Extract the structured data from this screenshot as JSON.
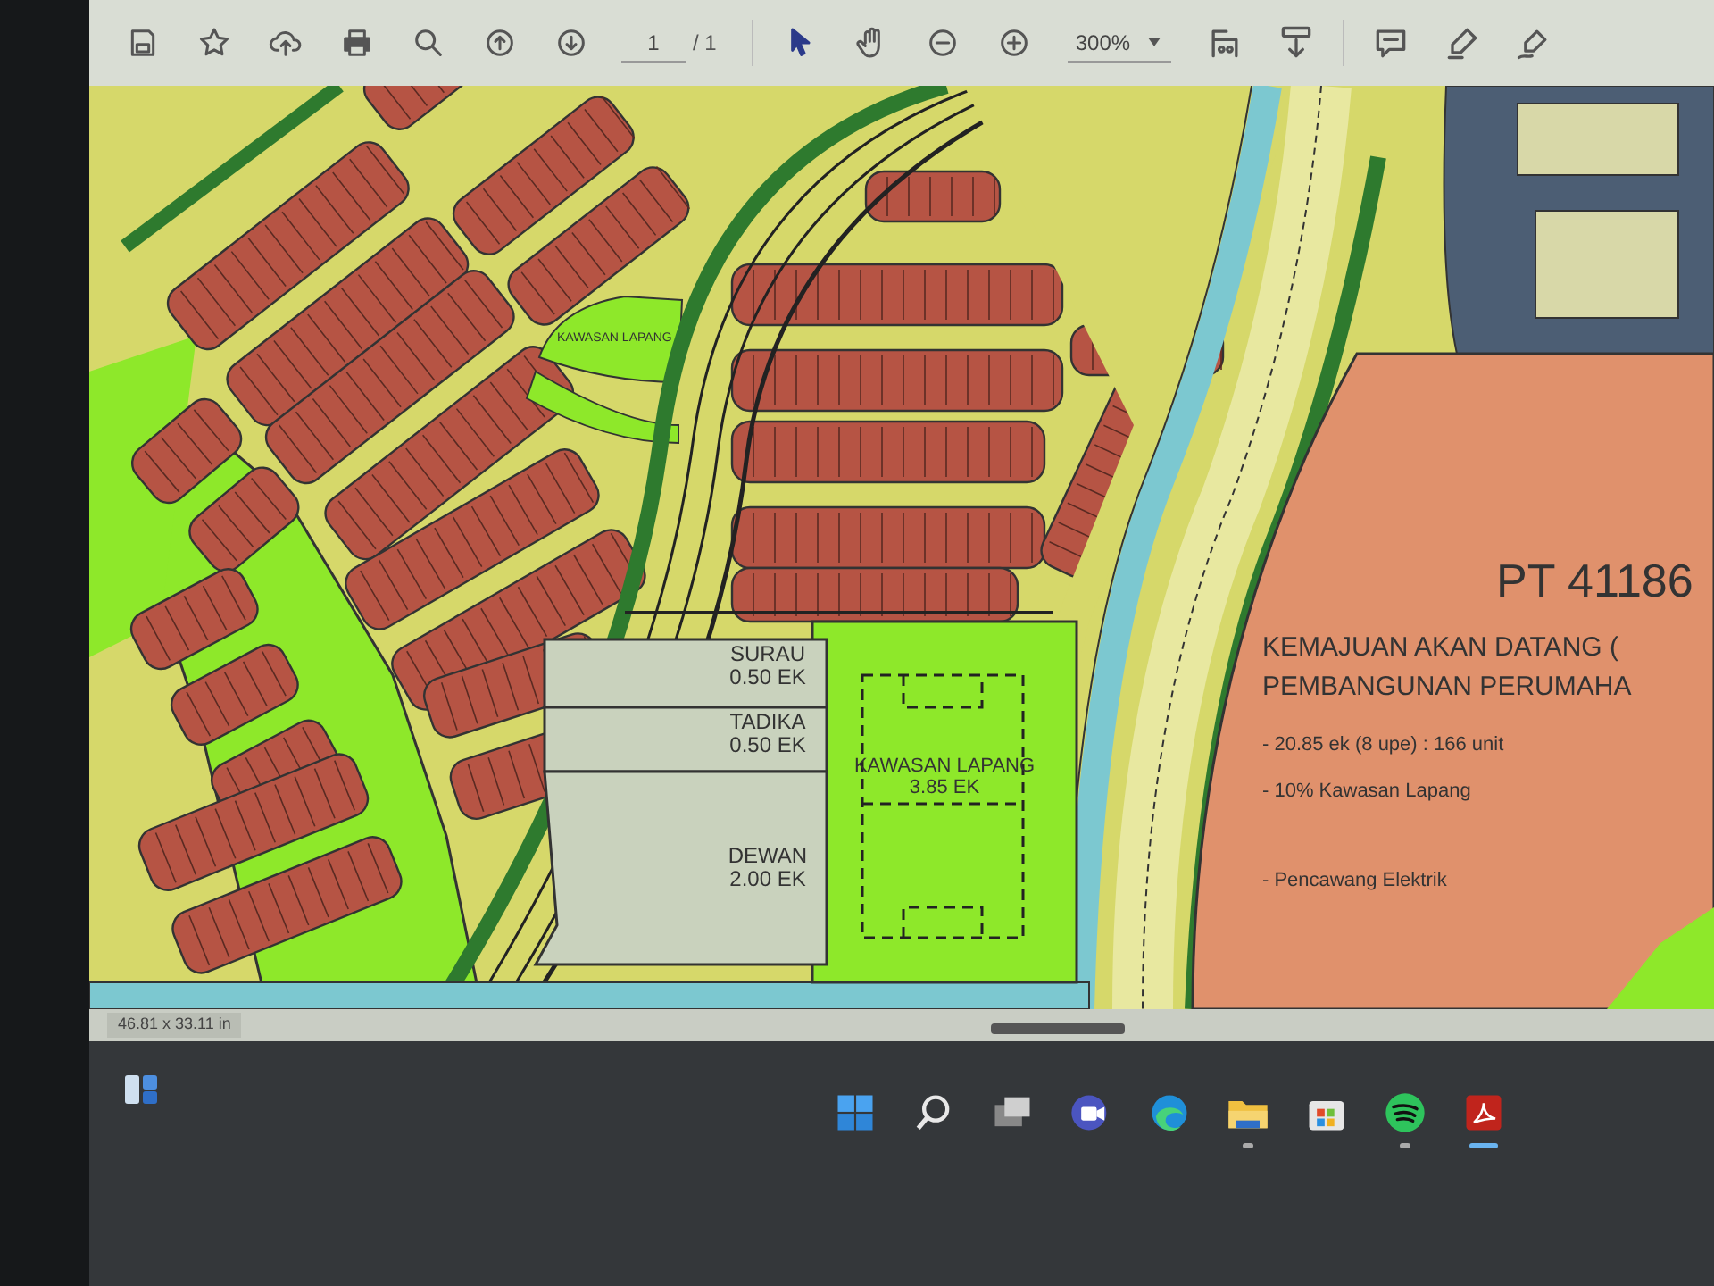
{
  "toolbar": {
    "page_number": "1",
    "page_total": "/ 1",
    "zoom": "300%"
  },
  "map": {
    "park_label": "KAWASAN LAPANG",
    "facilities": [
      {
        "name": "SURAU",
        "area": "0.50 EK"
      },
      {
        "name": "TADIKA",
        "area": "0.50 EK"
      },
      {
        "name": "DEWAN",
        "area": "2.00 EK"
      }
    ],
    "field": {
      "name": "KAWASAN LAPANG",
      "area": "3.85 EK"
    },
    "plot": {
      "title": "PT 41186",
      "heading": [
        "KEMAJUAN AKAN DATANG (",
        "PEMBANGUNAN PERUMAHA"
      ],
      "notes": [
        "- 20.85 ek (8 upe) : 166 unit",
        "- 10% Kawasan Lapang",
        "- Pencawang Elektrik"
      ]
    }
  },
  "status_bar": {
    "dimensions": "46.81 x 33.11 in"
  },
  "taskbar": {
    "apps": [
      {
        "kind": "start",
        "running": false,
        "active": false
      },
      {
        "kind": "search",
        "running": false,
        "active": false
      },
      {
        "kind": "task-view",
        "running": false,
        "active": false
      },
      {
        "kind": "video-call",
        "running": false,
        "active": false
      },
      {
        "kind": "browser",
        "running": false,
        "active": false
      },
      {
        "kind": "folder",
        "running": true,
        "active": false
      },
      {
        "kind": "store",
        "running": false,
        "active": false
      },
      {
        "kind": "music",
        "running": true,
        "active": false
      },
      {
        "kind": "pdf",
        "running": true,
        "active": true
      }
    ]
  }
}
